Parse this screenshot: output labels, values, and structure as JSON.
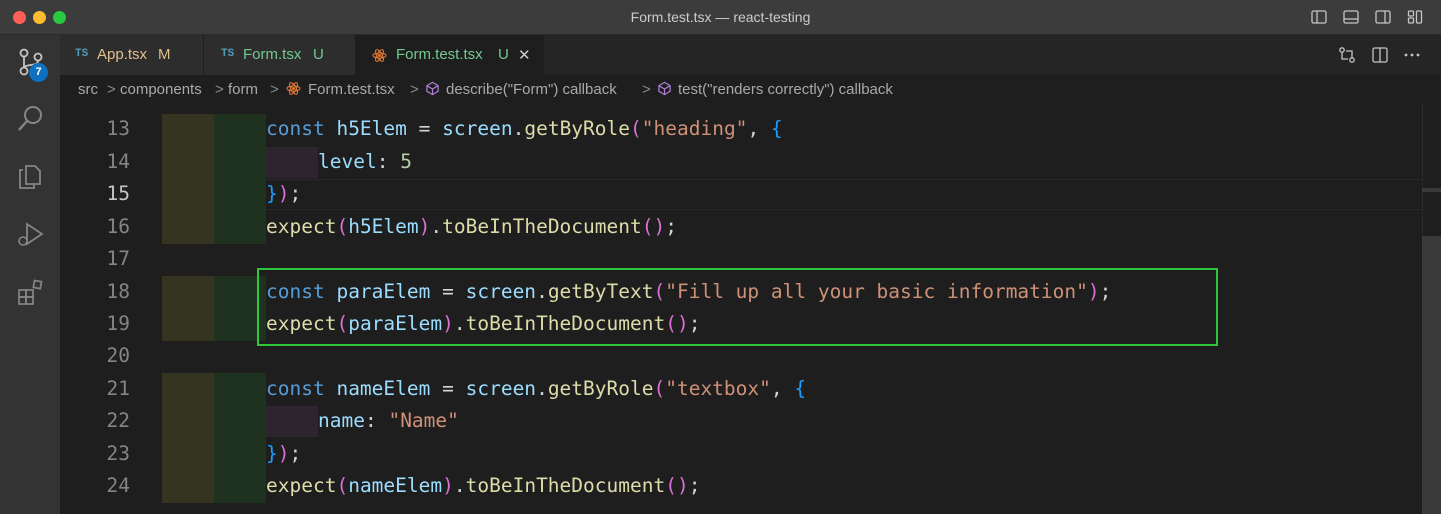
{
  "window": {
    "title": "Form.test.tsx — react-testing"
  },
  "activity": {
    "scm_badge": "7"
  },
  "tabs": [
    {
      "lang": "TS",
      "name": "App.tsx",
      "status": "M",
      "color": "#e2c08d"
    },
    {
      "lang": "TS",
      "name": "Form.tsx",
      "status": "U",
      "color": "#73c991"
    },
    {
      "lang": "",
      "name": "Form.test.tsx",
      "status": "U",
      "color": "#73c991",
      "close": "✕"
    }
  ],
  "breadcrumb": {
    "items": [
      "src",
      "components",
      "form",
      "Form.test.tsx",
      "describe(\"Form\") callback",
      "test(\"renders correctly\") callback"
    ],
    "separator": ">"
  },
  "editor": {
    "line_numbers": [
      "13",
      "14",
      "15",
      "16",
      "17",
      "18",
      "19",
      "20",
      "21",
      "22",
      "23",
      "24"
    ],
    "tokens": {
      "const": "const",
      "h5Elem": "h5Elem",
      "eq": " = ",
      "screen": "screen",
      "dot": ".",
      "getByRole": "getByRole",
      "lp": "(",
      "rp": ")",
      "heading": "\"heading\"",
      "comma_brace": ", ",
      "lbrace": "{",
      "rbrace": "}",
      "level": "level",
      "colon": ": ",
      "five": "5",
      "semi": ";",
      "expect": "expect",
      "toBeInTheDocument": "toBeInTheDocument",
      "empty_call": "()",
      "paraElem": "paraElem",
      "getByText": "getByText",
      "fill_text": "\"Fill up all your basic information\"",
      "nameElem": "nameElem",
      "textbox": "\"textbox\"",
      "name": "name",
      "name_val": "\"Name\""
    }
  }
}
